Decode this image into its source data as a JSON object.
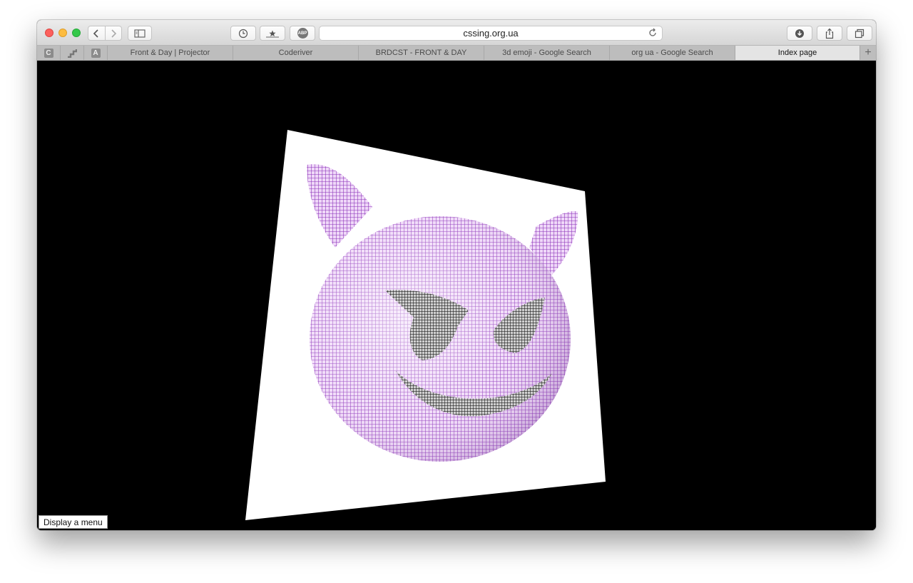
{
  "window": {
    "address": "cssing.org.ua",
    "buttons": {
      "back": "chevron-left-icon",
      "forward": "chevron-right-icon",
      "sidebar": "sidebar-icon",
      "history": "clock-icon",
      "bookmarks": "star-icon",
      "adblock": "ABP",
      "downloads": "download-icon",
      "share": "share-icon",
      "tabs": "tabs-overview-icon",
      "reload": "reload-icon"
    }
  },
  "tabs": {
    "pinned": [
      "C",
      "",
      "A"
    ],
    "items": [
      {
        "label": "Front & Day | Projector",
        "active": false
      },
      {
        "label": "Coderiver",
        "active": false
      },
      {
        "label": "BRDCST - FRONT & DAY",
        "active": false
      },
      {
        "label": "3d emoji - Google Search",
        "active": false
      },
      {
        "label": "org ua - Google Search",
        "active": false
      },
      {
        "label": "Index page",
        "active": true
      }
    ],
    "add_label": "+"
  },
  "page": {
    "menu_button": "Display a menu"
  },
  "colors": {
    "emoji_purple": "#a24ad0",
    "emoji_light": "#e8c8f4",
    "background": "#000000"
  }
}
